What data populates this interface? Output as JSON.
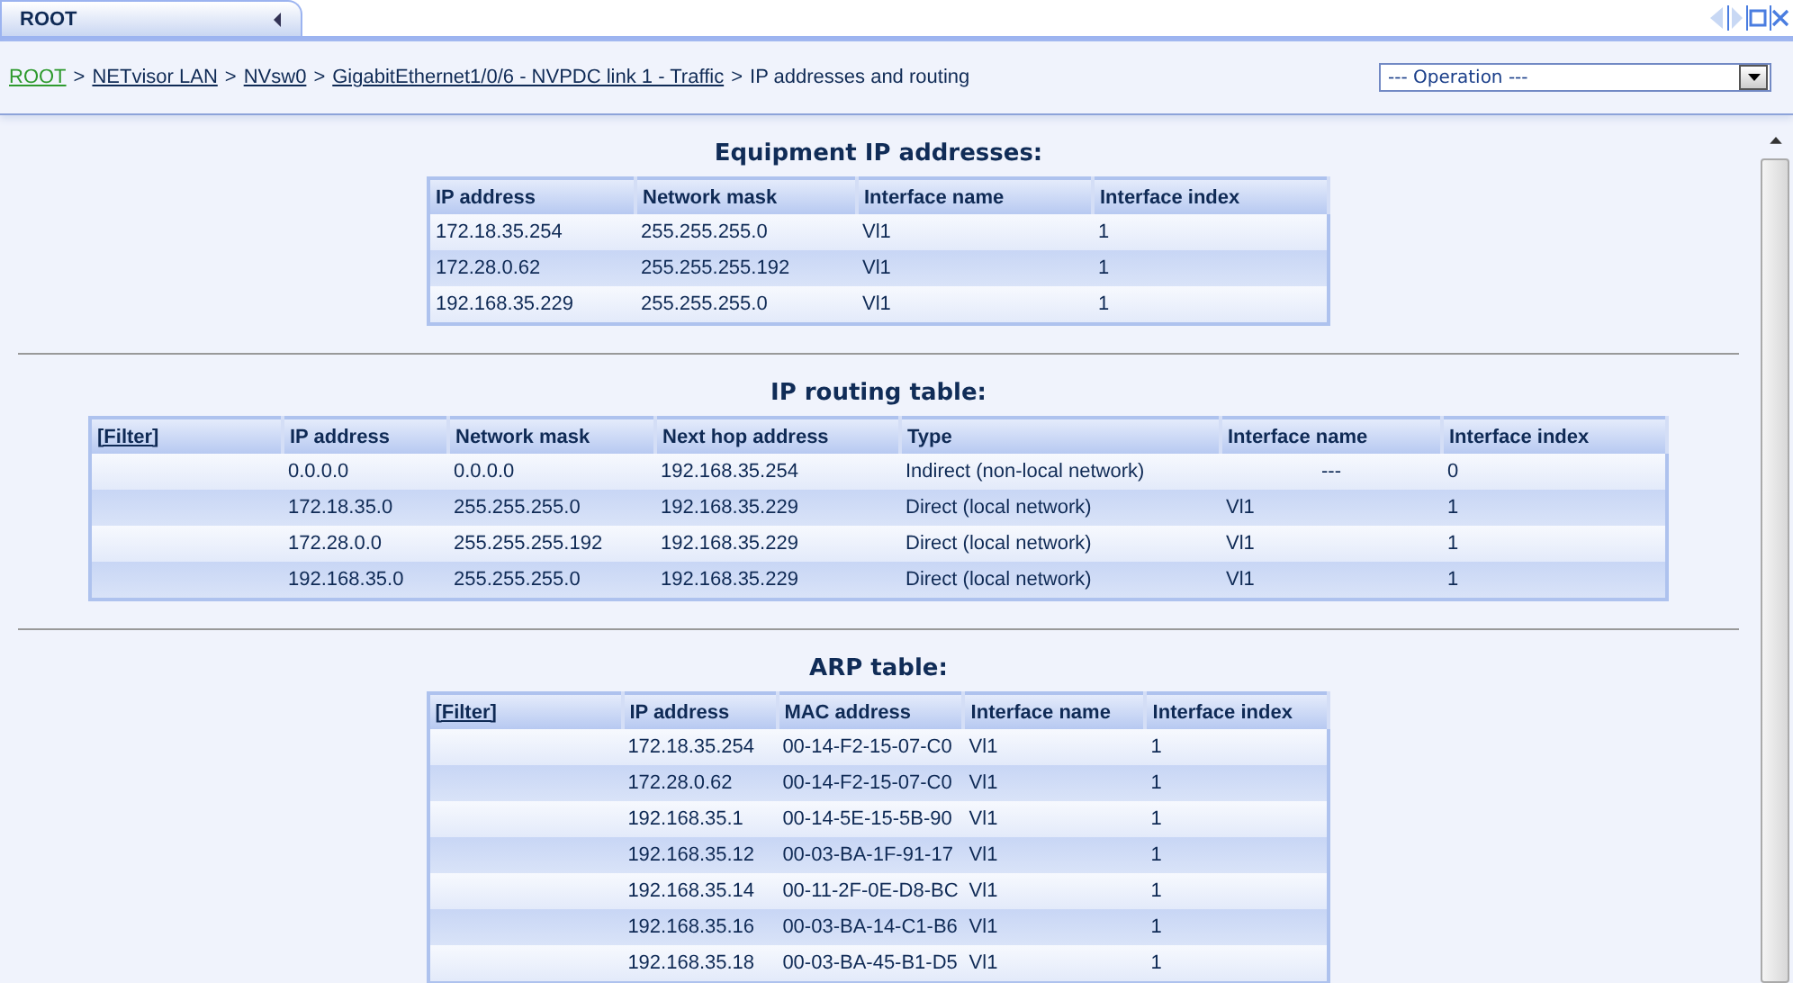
{
  "tab": {
    "label": "ROOT"
  },
  "breadcrumb": {
    "links": [
      "ROOT",
      "NETvisor LAN",
      "NVsw0",
      "GigabitEthernet1/0/6 - NVPDC link 1 - Traffic"
    ],
    "current": "IP addresses and routing",
    "separator": ">"
  },
  "operation_select": {
    "value": "--- Operation ---"
  },
  "sections": [
    {
      "title": "Equipment IP addresses:",
      "columns": [
        {
          "label": "IP address",
          "kind": "text"
        },
        {
          "label": "Network mask",
          "kind": "text"
        },
        {
          "label": "Interface name",
          "kind": "text"
        },
        {
          "label": "Interface index",
          "kind": "text"
        }
      ],
      "rows": [
        [
          "172.18.35.254",
          "255.255.255.0",
          "Vl1",
          "1"
        ],
        [
          "172.28.0.62",
          "255.255.255.192",
          "Vl1",
          "1"
        ],
        [
          "192.168.35.229",
          "255.255.255.0",
          "Vl1",
          "1"
        ]
      ]
    },
    {
      "title": "IP routing table:",
      "columns": [
        {
          "label": "[Filter]",
          "kind": "link"
        },
        {
          "label": "IP address",
          "kind": "text"
        },
        {
          "label": "Network mask",
          "kind": "text"
        },
        {
          "label": "Next hop address",
          "kind": "text"
        },
        {
          "label": "Type",
          "kind": "text"
        },
        {
          "label": "Interface name",
          "kind": "text"
        },
        {
          "label": "Interface index",
          "kind": "text"
        }
      ],
      "rows": [
        [
          "",
          "0.0.0.0",
          "0.0.0.0",
          "192.168.35.254",
          "Indirect (non-local network)",
          "---",
          "0"
        ],
        [
          "",
          "172.18.35.0",
          "255.255.255.0",
          "192.168.35.229",
          "Direct (local network)",
          "Vl1",
          "1"
        ],
        [
          "",
          "172.28.0.0",
          "255.255.255.192",
          "192.168.35.229",
          "Direct (local network)",
          "Vl1",
          "1"
        ],
        [
          "",
          "192.168.35.0",
          "255.255.255.0",
          "192.168.35.229",
          "Direct (local network)",
          "Vl1",
          "1"
        ]
      ]
    },
    {
      "title": "ARP table:",
      "columns": [
        {
          "label": "[Filter]",
          "kind": "link"
        },
        {
          "label": "IP address",
          "kind": "text"
        },
        {
          "label": "MAC address",
          "kind": "text"
        },
        {
          "label": "Interface name",
          "kind": "text"
        },
        {
          "label": "Interface index",
          "kind": "text"
        }
      ],
      "rows": [
        [
          "",
          "172.18.35.254",
          "00-14-F2-15-07-C0",
          "Vl1",
          "1"
        ],
        [
          "",
          "172.28.0.62",
          "00-14-F2-15-07-C0",
          "Vl1",
          "1"
        ],
        [
          "",
          "192.168.35.1",
          "00-14-5E-15-5B-90",
          "Vl1",
          "1"
        ],
        [
          "",
          "192.168.35.12",
          "00-03-BA-1F-91-17",
          "Vl1",
          "1"
        ],
        [
          "",
          "192.168.35.14",
          "00-11-2F-0E-D8-BC",
          "Vl1",
          "1"
        ],
        [
          "",
          "192.168.35.16",
          "00-03-BA-14-C1-B6",
          "Vl1",
          "1"
        ],
        [
          "",
          "192.168.35.18",
          "00-03-BA-45-B1-D5",
          "Vl1",
          "1"
        ]
      ]
    }
  ]
}
